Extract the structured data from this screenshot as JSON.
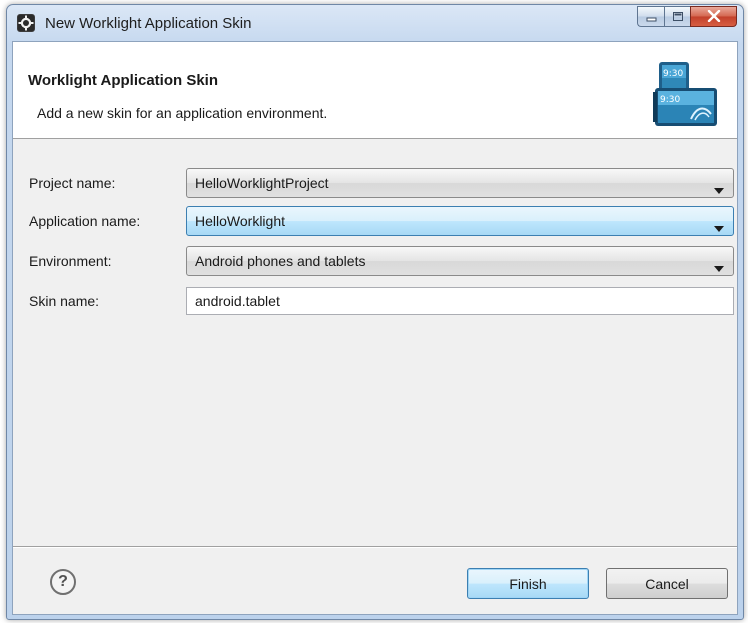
{
  "window": {
    "title": "New Worklight Application Skin",
    "icon": "eclipse-icon"
  },
  "title_controls": {
    "minimize_icon": "minimize-icon",
    "maximize_icon": "maximize-icon",
    "close_icon": "close-icon"
  },
  "banner": {
    "title": "Worklight Application Skin",
    "description": "Add a new skin for an application environment.",
    "image": "device-skin-icon",
    "image_clock_1": "9:30",
    "image_clock_2": "9:30"
  },
  "form": {
    "project_name": {
      "label": "Project name:",
      "value": "HelloWorklightProject"
    },
    "application_name": {
      "label": "Application name:",
      "value": "HelloWorklight"
    },
    "environment": {
      "label": "Environment:",
      "value": "Android phones and tablets"
    },
    "skin_name": {
      "label": "Skin name:",
      "value": "android.tablet"
    }
  },
  "footer": {
    "help_symbol": "?",
    "finish_label": "Finish",
    "cancel_label": "Cancel"
  },
  "colors": {
    "focus_border": "#3c7fb1",
    "close_red": "#c2402b",
    "dialog_background": "#f0f0f0"
  }
}
